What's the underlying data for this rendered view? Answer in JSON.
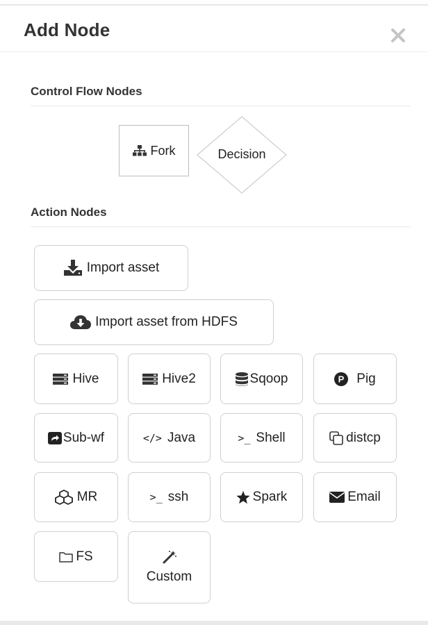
{
  "dialog": {
    "title": "Add Node",
    "close_icon": "close-icon"
  },
  "control_flow": {
    "title": "Control Flow Nodes",
    "fork": {
      "label": "Fork",
      "icon": "sitemap-icon"
    },
    "decision": {
      "label": "Decision"
    }
  },
  "actions": {
    "title": "Action Nodes",
    "import_asset": {
      "label": "Import asset",
      "icon": "download-icon"
    },
    "import_hdfs": {
      "label": "Import asset from HDFS",
      "icon": "cloud-download-icon"
    },
    "hive": {
      "label": "Hive",
      "icon": "server-icon"
    },
    "hive2": {
      "label": "Hive2",
      "icon": "server-icon"
    },
    "sqoop": {
      "label": "Sqoop",
      "icon": "database-icon"
    },
    "pig": {
      "label": "Pig",
      "icon": "pig-icon",
      "glyph": "P"
    },
    "subwf": {
      "label": "Sub-wf",
      "icon": "share-square-icon"
    },
    "java": {
      "label": "Java",
      "icon": "code-icon",
      "glyph": "</>"
    },
    "shell": {
      "label": "Shell",
      "icon": "terminal-icon",
      "glyph": ">_"
    },
    "distcp": {
      "label": "distcp",
      "icon": "copy-icon"
    },
    "mr": {
      "label": "MR",
      "icon": "cubes-icon"
    },
    "ssh": {
      "label": "ssh",
      "icon": "terminal-icon",
      "glyph": ">_"
    },
    "spark": {
      "label": "Spark",
      "icon": "star-icon"
    },
    "email": {
      "label": "Email",
      "icon": "envelope-icon"
    },
    "fs": {
      "label": "FS",
      "icon": "folder-icon"
    },
    "custom": {
      "label": "Custom",
      "icon": "magic-wand-icon"
    }
  },
  "colors": {
    "border": "#cfcfcf",
    "text": "#222222",
    "icon": "#333333"
  }
}
